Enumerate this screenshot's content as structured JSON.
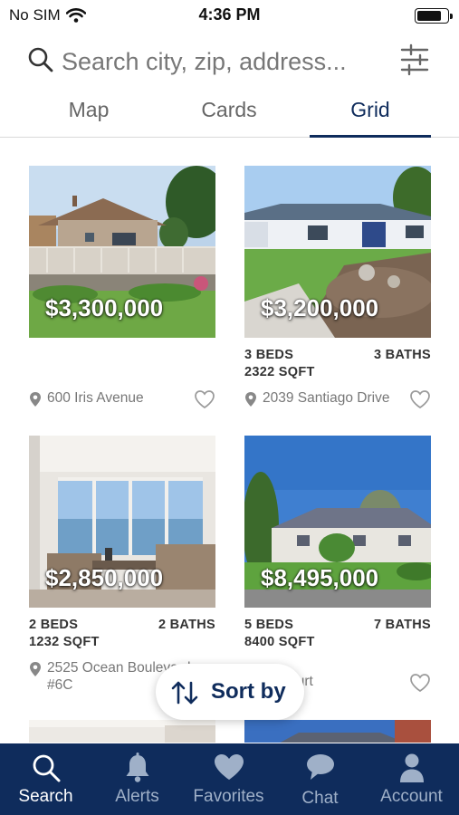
{
  "status_bar": {
    "carrier": "No SIM",
    "time": "4:36 PM",
    "battery_level": 0.85
  },
  "search": {
    "placeholder": "Search city, zip, address..."
  },
  "tabs": [
    {
      "label": "Map",
      "active": false
    },
    {
      "label": "Cards",
      "active": false
    },
    {
      "label": "Grid",
      "active": true
    }
  ],
  "listings": [
    {
      "price": "$3,300,000",
      "beds": "",
      "baths": "",
      "sqft": "",
      "address": "600 Iris Avenue"
    },
    {
      "price": "$3,200,000",
      "beds": "3 BEDS",
      "baths": "3 BATHS",
      "sqft": "2322 SQFT",
      "address": "2039 Santiago Drive"
    },
    {
      "price": "$2,850,000",
      "beds": "2 BEDS",
      "baths": "2 BATHS",
      "sqft": "1232 SQFT",
      "address": "2525 Ocean Boulevard #6C"
    },
    {
      "price": "$8,495,000",
      "beds": "5 BEDS",
      "baths": "7 BATHS",
      "sqft": "8400 SQFT",
      "address": "shire Court"
    }
  ],
  "sort": {
    "label": "Sort by"
  },
  "nav": [
    {
      "label": "Search",
      "icon": "search-icon",
      "active": true
    },
    {
      "label": "Alerts",
      "icon": "bell-icon",
      "active": false
    },
    {
      "label": "Favorites",
      "icon": "heart-icon",
      "active": false
    },
    {
      "label": "Chat",
      "icon": "chat-bubble-icon",
      "active": false
    },
    {
      "label": "Account",
      "icon": "person-icon",
      "active": false
    }
  ],
  "colors": {
    "brand_navy": "#0f2c5c",
    "inactive_nav": "#9fb0c8",
    "muted_text": "#777777"
  }
}
